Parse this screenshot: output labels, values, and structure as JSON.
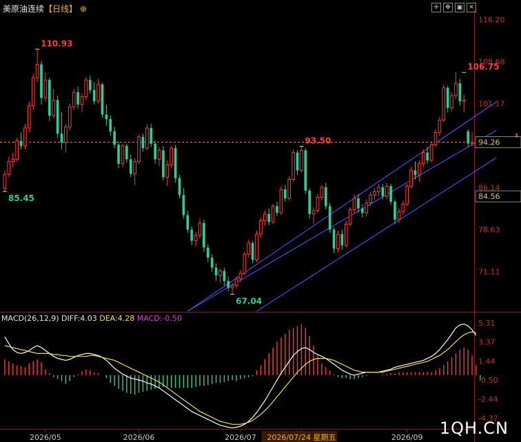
{
  "header": {
    "title": "美原油连续",
    "period": "【日线】",
    "toolbar_icons": [
      "crosshair-icon",
      "move-icon",
      "image-icon",
      "close-icon"
    ]
  },
  "macd_legend": {
    "name": "MACD(26,12,9)",
    "diff": "DIFF:4.03",
    "dea": "DEA:4.28",
    "macd": "MACD:-0.50"
  },
  "watermark": "1QH.CN",
  "colors": {
    "up": "#ff3b3b",
    "down": "#2ecc9a",
    "channel": "#5a5aff",
    "diff_line": "#ffffff",
    "dea_line": "#f0e05a",
    "price_label": "#ff3b3b",
    "axis_text": "#c03030",
    "current_line": "#f08a1e"
  },
  "chart_data": [
    {
      "type": "candlestick",
      "name": "price",
      "ylim": [
        64,
        117.5
      ],
      "yticks": [
        "116.20",
        "108.68",
        "101.17",
        "93.65",
        "86.14",
        "78.63",
        "71.11"
      ],
      "ytick_values": [
        116.2,
        108.68,
        101.17,
        93.65,
        86.14,
        78.63,
        71.11
      ],
      "xticks": [
        "2026/05",
        "2026/06",
        "2026/07",
        "2026/07/24 星期五",
        "2026/09"
      ],
      "xtick_index": [
        10,
        33,
        58,
        73,
        99
      ],
      "current_price": 94.26,
      "hline_label": "84.56",
      "hline_value": 84.56,
      "annotations": [
        {
          "text": "110.93",
          "value": 110.93,
          "index": 8,
          "kind": "high"
        },
        {
          "text": "85.45",
          "value": 85.45,
          "index": 0,
          "kind": "low"
        },
        {
          "text": "93.50",
          "value": 93.5,
          "index": 73,
          "kind": "high"
        },
        {
          "text": "67.04",
          "value": 67.04,
          "index": 56,
          "kind": "low"
        },
        {
          "text": "106.75",
          "value": 106.75,
          "index": 113,
          "kind": "high"
        }
      ],
      "channel": [
        {
          "i1": 45,
          "v1": 64.0,
          "i2": 121,
          "v2": 101.5
        },
        {
          "i1": 45,
          "v1": 64.0,
          "i2": 121,
          "v2": 96.4
        },
        {
          "i1": 62,
          "v1": 64.0,
          "i2": 121,
          "v2": 91.5
        }
      ],
      "ohlc": [
        [
          86.0,
          89.2,
          85.45,
          88.5
        ],
        [
          88.5,
          91.6,
          88.0,
          90.8
        ],
        [
          90.8,
          92.4,
          89.8,
          91.2
        ],
        [
          91.2,
          95.0,
          90.8,
          94.5
        ],
        [
          94.5,
          96.0,
          93.0,
          93.6
        ],
        [
          93.6,
          97.5,
          93.0,
          96.8
        ],
        [
          96.8,
          101.5,
          96.0,
          100.8
        ],
        [
          100.8,
          106.5,
          100.0,
          105.8
        ],
        [
          105.8,
          110.93,
          105.0,
          108.2
        ],
        [
          108.2,
          108.8,
          101.0,
          102.2
        ],
        [
          102.2,
          106.8,
          101.5,
          105.4
        ],
        [
          105.4,
          105.8,
          98.0,
          99.0
        ],
        [
          99.0,
          103.8,
          98.5,
          101.8
        ],
        [
          101.8,
          102.6,
          95.0,
          95.8
        ],
        [
          95.8,
          99.6,
          93.0,
          94.2
        ],
        [
          94.2,
          97.5,
          92.4,
          97.0
        ],
        [
          97.0,
          101.2,
          96.4,
          100.6
        ],
        [
          100.6,
          103.8,
          100.0,
          103.2
        ],
        [
          103.2,
          104.2,
          100.2,
          101.0
        ],
        [
          101.0,
          103.0,
          99.6,
          102.4
        ],
        [
          102.4,
          106.0,
          101.8,
          105.4
        ],
        [
          105.4,
          106.2,
          103.0,
          103.6
        ],
        [
          103.6,
          105.0,
          101.0,
          101.6
        ],
        [
          101.6,
          105.6,
          101.2,
          104.6
        ],
        [
          104.6,
          104.9,
          98.6,
          99.2
        ],
        [
          99.2,
          101.0,
          97.2,
          98.4
        ],
        [
          98.4,
          99.0,
          95.4,
          96.2
        ],
        [
          96.2,
          97.0,
          93.2,
          93.8
        ],
        [
          93.8,
          94.4,
          89.6,
          90.4
        ],
        [
          90.4,
          94.0,
          89.8,
          93.6
        ],
        [
          93.6,
          94.0,
          90.6,
          91.2
        ],
        [
          91.2,
          92.0,
          88.0,
          88.6
        ],
        [
          88.6,
          91.4,
          86.6,
          90.8
        ],
        [
          90.8,
          95.6,
          90.4,
          95.2
        ],
        [
          95.2,
          95.8,
          92.6,
          93.2
        ],
        [
          93.2,
          97.5,
          92.8,
          96.8
        ],
        [
          96.8,
          97.6,
          93.4,
          94.0
        ],
        [
          94.0,
          94.6,
          90.4,
          91.2
        ],
        [
          91.2,
          93.4,
          90.0,
          92.8
        ],
        [
          92.8,
          93.6,
          87.4,
          88.0
        ],
        [
          88.0,
          91.0,
          86.4,
          90.2
        ],
        [
          90.2,
          93.6,
          89.6,
          93.2
        ],
        [
          93.2,
          93.8,
          87.0,
          87.8
        ],
        [
          87.8,
          88.4,
          84.2,
          84.8
        ],
        [
          84.8,
          86.0,
          80.6,
          81.2
        ],
        [
          81.2,
          82.0,
          78.0,
          78.6
        ],
        [
          78.6,
          79.2,
          75.8,
          76.6
        ],
        [
          76.6,
          78.2,
          75.6,
          77.6
        ],
        [
          77.6,
          80.6,
          77.0,
          79.8
        ],
        [
          79.8,
          80.4,
          74.6,
          75.4
        ],
        [
          75.4,
          76.0,
          72.8,
          73.6
        ],
        [
          73.6,
          74.2,
          71.0,
          71.8
        ],
        [
          71.8,
          72.6,
          69.4,
          70.4
        ],
        [
          70.4,
          71.6,
          69.0,
          71.2
        ],
        [
          71.2,
          71.8,
          68.6,
          69.4
        ],
        [
          69.4,
          70.2,
          67.6,
          68.2
        ],
        [
          68.2,
          69.0,
          67.04,
          68.6
        ],
        [
          68.6,
          70.2,
          68.0,
          69.8
        ],
        [
          69.8,
          71.4,
          69.2,
          70.8
        ],
        [
          70.8,
          74.6,
          70.4,
          74.2
        ],
        [
          74.2,
          76.8,
          73.6,
          76.2
        ],
        [
          76.2,
          76.6,
          72.6,
          73.2
        ],
        [
          73.2,
          78.4,
          72.8,
          77.8
        ],
        [
          77.8,
          80.8,
          77.2,
          80.2
        ],
        [
          80.2,
          82.0,
          79.2,
          81.4
        ],
        [
          81.4,
          82.4,
          79.4,
          80.0
        ],
        [
          80.0,
          83.2,
          79.6,
          82.8
        ],
        [
          82.8,
          83.6,
          81.0,
          81.6
        ],
        [
          81.6,
          86.4,
          81.2,
          85.8
        ],
        [
          85.8,
          86.6,
          83.6,
          84.2
        ],
        [
          84.2,
          88.2,
          83.8,
          87.6
        ],
        [
          87.6,
          93.0,
          87.2,
          92.4
        ],
        [
          92.4,
          92.8,
          88.4,
          89.2
        ],
        [
          89.2,
          93.5,
          88.8,
          92.8
        ],
        [
          92.8,
          93.2,
          85.0,
          85.6
        ],
        [
          85.6,
          86.0,
          80.6,
          81.4
        ],
        [
          81.4,
          82.6,
          79.6,
          82.0
        ],
        [
          82.0,
          85.0,
          81.6,
          84.4
        ],
        [
          84.4,
          86.6,
          83.8,
          86.2
        ],
        [
          86.2,
          87.0,
          82.2,
          82.8
        ],
        [
          82.8,
          83.4,
          78.0,
          78.6
        ],
        [
          78.6,
          79.0,
          74.4,
          75.2
        ],
        [
          75.2,
          78.4,
          74.6,
          77.8
        ],
        [
          77.8,
          78.6,
          75.0,
          75.8
        ],
        [
          75.8,
          80.2,
          75.4,
          79.6
        ],
        [
          79.6,
          82.6,
          79.2,
          82.2
        ],
        [
          82.2,
          84.8,
          81.6,
          84.2
        ],
        [
          84.2,
          85.0,
          81.6,
          82.4
        ],
        [
          82.4,
          83.2,
          80.8,
          81.6
        ],
        [
          81.6,
          84.0,
          81.0,
          83.4
        ],
        [
          83.4,
          85.4,
          82.8,
          84.8
        ],
        [
          84.8,
          86.0,
          84.0,
          85.4
        ],
        [
          85.4,
          86.8,
          84.6,
          86.2
        ],
        [
          86.2,
          86.8,
          84.0,
          84.6
        ],
        [
          84.6,
          87.0,
          84.0,
          86.4
        ],
        [
          86.4,
          86.8,
          83.0,
          83.6
        ],
        [
          83.6,
          84.0,
          79.6,
          80.4
        ],
        [
          80.4,
          82.4,
          79.8,
          81.8
        ],
        [
          81.8,
          83.8,
          81.2,
          83.2
        ],
        [
          83.2,
          86.8,
          82.8,
          86.4
        ],
        [
          86.4,
          89.8,
          86.0,
          89.2
        ],
        [
          89.2,
          90.8,
          87.6,
          88.4
        ],
        [
          88.4,
          91.0,
          87.2,
          90.4
        ],
        [
          90.4,
          93.0,
          89.8,
          92.4
        ],
        [
          92.4,
          93.4,
          90.4,
          91.0
        ],
        [
          91.0,
          94.4,
          90.6,
          93.8
        ],
        [
          93.8,
          96.6,
          93.4,
          96.0
        ],
        [
          96.0,
          98.8,
          95.4,
          98.2
        ],
        [
          98.2,
          104.6,
          97.8,
          104.0
        ],
        [
          104.0,
          104.4,
          99.6,
          100.4
        ],
        [
          100.4,
          103.2,
          99.8,
          102.6
        ],
        [
          102.6,
          106.75,
          102.0,
          104.8
        ],
        [
          104.8,
          105.6,
          100.8,
          101.6
        ],
        [
          101.6,
          102.8,
          99.6,
          101.8
        ],
        [
          96.2,
          96.6,
          93.4,
          94.0
        ],
        [
          94.0,
          96.0,
          93.6,
          94.26
        ]
      ]
    },
    {
      "type": "line+bar",
      "name": "MACD",
      "ylim": [
        -5.4,
        5.8
      ],
      "yticks": [
        "5.31",
        "3.37",
        "1.44",
        "-0.50",
        "-2.44",
        "-4.37"
      ],
      "ytick_values": [
        5.31,
        3.37,
        1.44,
        -0.5,
        -2.44,
        -4.37
      ],
      "series": [
        {
          "name": "DIFF",
          "values": [
            3.9,
            3.2,
            2.6,
            2.3,
            2.2,
            2.3,
            2.5,
            2.8,
            3.0,
            2.8,
            2.5,
            2.2,
            1.9,
            1.7,
            1.6,
            1.5,
            1.6,
            1.8,
            2.0,
            2.1,
            2.2,
            2.2,
            2.1,
            2.0,
            1.8,
            1.5,
            1.1,
            0.7,
            0.4,
            0.1,
            -0.1,
            -0.3,
            -0.4,
            -0.5,
            -0.6,
            -0.8,
            -0.9,
            -1.1,
            -1.3,
            -1.6,
            -1.9,
            -2.2,
            -2.5,
            -2.8,
            -3.1,
            -3.4,
            -3.7,
            -3.9,
            -4.1,
            -4.3,
            -4.5,
            -4.7,
            -4.9,
            -5.1,
            -5.2,
            -5.3,
            -5.35,
            -5.3,
            -5.2,
            -5.0,
            -4.7,
            -4.3,
            -3.8,
            -3.2,
            -2.6,
            -1.9,
            -1.2,
            -0.5,
            0.2,
            0.8,
            1.4,
            2.0,
            2.4,
            2.7,
            2.8,
            2.6,
            2.3,
            2.1,
            1.9,
            1.7,
            1.4,
            1.1,
            0.8,
            0.5,
            0.3,
            0.1,
            0.0,
            0.1,
            0.2,
            0.3,
            0.3,
            0.3,
            0.3,
            0.4,
            0.5,
            0.6,
            0.8,
            0.9,
            1.0,
            1.1,
            1.2,
            1.3,
            1.4,
            1.5,
            1.7,
            1.9,
            2.2,
            2.6,
            3.1,
            3.6,
            4.2,
            4.8,
            5.1,
            5.2,
            5.0,
            4.6,
            4.03
          ]
        },
        {
          "name": "DEA",
          "values": [
            3.0,
            2.9,
            2.8,
            2.7,
            2.6,
            2.5,
            2.4,
            2.3,
            2.2,
            2.2,
            2.2,
            2.2,
            2.1,
            2.1,
            2.0,
            2.0,
            1.9,
            1.9,
            1.9,
            1.9,
            1.9,
            2.0,
            2.0,
            1.9,
            1.8,
            1.7,
            1.6,
            1.5,
            1.3,
            1.1,
            0.9,
            0.7,
            0.5,
            0.3,
            0.1,
            -0.1,
            -0.3,
            -0.5,
            -0.7,
            -1.0,
            -1.3,
            -1.6,
            -1.9,
            -2.2,
            -2.5,
            -2.8,
            -3.1,
            -3.4,
            -3.7,
            -3.9,
            -4.1,
            -4.3,
            -4.5,
            -4.7,
            -4.8,
            -4.9,
            -5.0,
            -5.0,
            -5.0,
            -4.9,
            -4.8,
            -4.6,
            -4.3,
            -4.0,
            -3.6,
            -3.2,
            -2.7,
            -2.2,
            -1.7,
            -1.2,
            -0.7,
            -0.2,
            0.3,
            0.7,
            1.1,
            1.4,
            1.6,
            1.7,
            1.7,
            1.7,
            1.6,
            1.5,
            1.3,
            1.1,
            0.9,
            0.7,
            0.5,
            0.4,
            0.3,
            0.3,
            0.3,
            0.3,
            0.3,
            0.3,
            0.4,
            0.5,
            0.6,
            0.7,
            0.8,
            0.9,
            1.0,
            1.1,
            1.2,
            1.3,
            1.4,
            1.6,
            1.8,
            2.0,
            2.3,
            2.6,
            3.0,
            3.4,
            3.8,
            4.1,
            4.3,
            4.4,
            4.28
          ]
        },
        {
          "name": "MACD",
          "values": [
            1.6,
            1.4,
            1.2,
            1.0,
            0.9,
            0.8,
            1.2,
            1.4,
            1.6,
            1.3,
            0.6,
            0.2,
            -0.2,
            -0.4,
            -0.6,
            -0.9,
            -0.6,
            -0.2,
            0.1,
            0.4,
            0.6,
            0.5,
            0.3,
            0.2,
            0.0,
            -0.3,
            -0.8,
            -1.1,
            -1.4,
            -1.6,
            -1.8,
            -1.9,
            -2.0,
            -1.8,
            -1.7,
            -1.6,
            -1.5,
            -1.4,
            -1.3,
            -1.2,
            -1.2,
            -1.3,
            -1.3,
            -1.3,
            -1.3,
            -1.3,
            -1.3,
            -1.2,
            -1.1,
            -1.1,
            -1.0,
            -0.9,
            -0.8,
            -0.8,
            -0.7,
            -0.6,
            -0.5,
            -0.6,
            -0.4,
            -0.3,
            -0.2,
            -0.1,
            0.5,
            1.0,
            1.6,
            2.2,
            2.8,
            3.4,
            3.8,
            4.2,
            4.6,
            4.8,
            5.0,
            5.2,
            4.8,
            4.0,
            3.0,
            2.0,
            1.2,
            0.8,
            0.4,
            0.1,
            -0.2,
            -0.3,
            -0.3,
            -0.4,
            -0.4,
            -0.3,
            -0.2,
            -0.1,
            0.0,
            0.0,
            0.0,
            0.1,
            0.1,
            0.2,
            0.2,
            0.3,
            0.3,
            0.3,
            0.3,
            0.3,
            0.3,
            0.3,
            0.3,
            0.3,
            0.5,
            0.7,
            1.0,
            1.4,
            1.8,
            2.2,
            2.6,
            2.8,
            2.6,
            2.0,
            1.0,
            -0.5
          ]
        }
      ]
    }
  ]
}
